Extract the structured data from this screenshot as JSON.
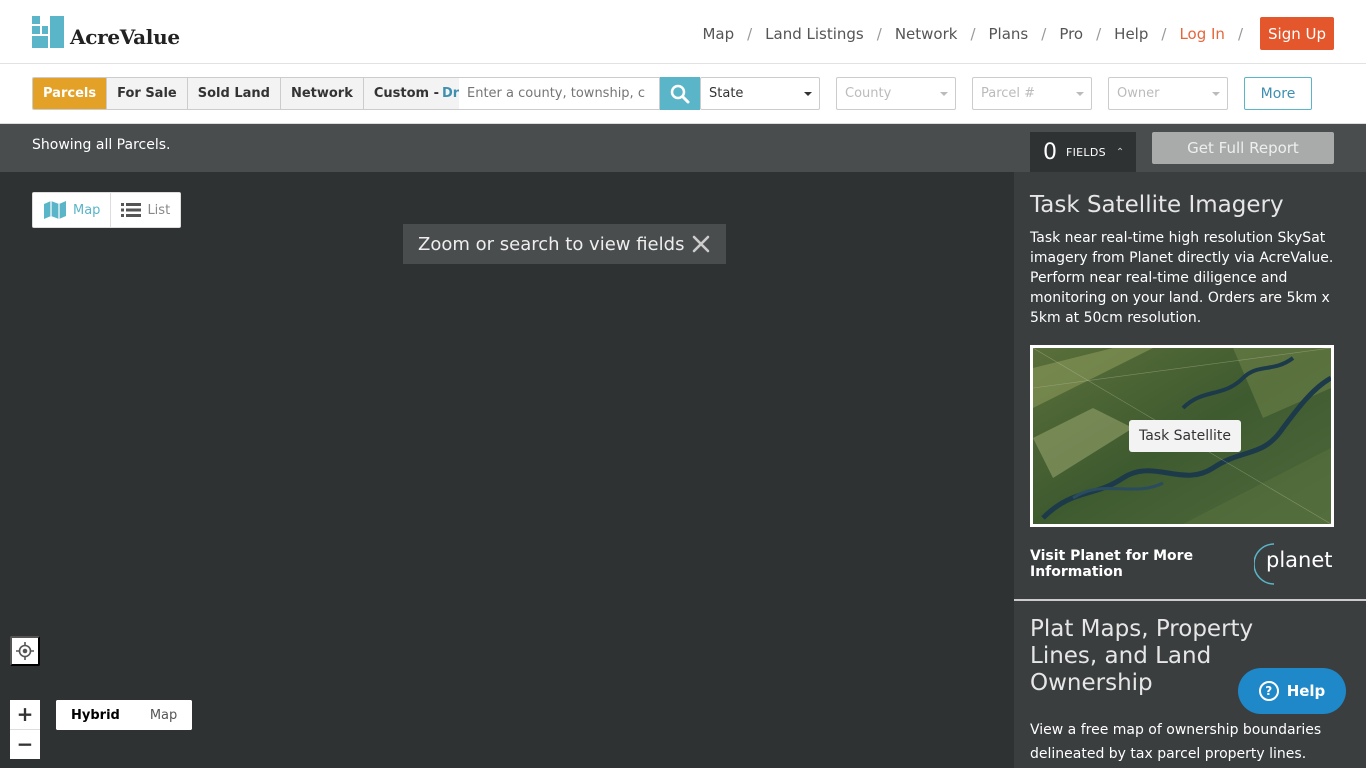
{
  "brand": {
    "name": "AcreValue"
  },
  "nav": {
    "items": [
      "Map",
      "Land Listings",
      "Network",
      "Plans",
      "Pro",
      "Help",
      "Log In"
    ],
    "separator": "/",
    "signup": "Sign Up"
  },
  "toolbar": {
    "layers": [
      "Parcels",
      "For Sale",
      "Sold Land",
      "Network"
    ],
    "custom": "Custom -",
    "draw": "Draw",
    "search_placeholder": "Enter a county, township, c",
    "state": "State",
    "county": "County",
    "parcel": "Parcel #",
    "owner": "Owner",
    "more": "More"
  },
  "status": {
    "showing": "Showing all Parcels.",
    "fields_count": "0",
    "fields_label": "FIELDS",
    "report": "Get Full Report"
  },
  "map": {
    "view_map": "Map",
    "view_list": "List",
    "notice": "Zoom or search to view fields",
    "zoom_in": "+",
    "zoom_out": "−",
    "type_hybrid": "Hybrid",
    "type_map": "Map"
  },
  "sidebar": {
    "title": "Task Satellite Imagery",
    "description": "Task near real-time high resolution SkySat imagery from Planet directly via AcreValue. Perform near real-time diligence and monitoring on your land. Orders are 5km x 5km at 50cm resolution.",
    "task_button": "Task Satellite",
    "visit": "Visit Planet for More Information",
    "planet": "planet",
    "title2": "Plat Maps, Property Lines, and Land Ownership",
    "description2": "View a free map of ownership boundaries delineated by tax parcel property lines."
  },
  "help": {
    "label": "Help"
  },
  "colors": {
    "accent": "#5bb5c8",
    "active_layer": "#e3a128",
    "signup": "#e4562b",
    "help": "#1e88c8"
  }
}
